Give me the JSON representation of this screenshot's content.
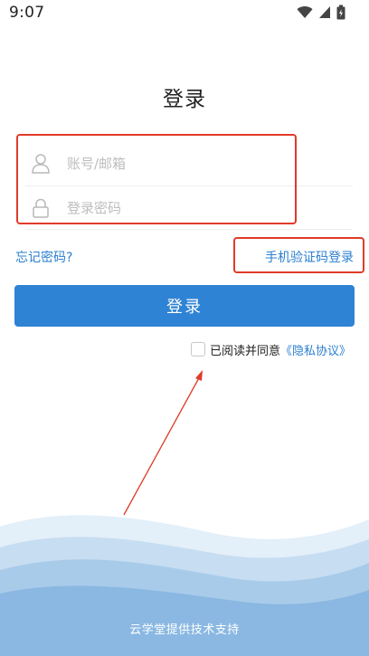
{
  "status_bar": {
    "time": "9:07"
  },
  "page": {
    "title": "登录"
  },
  "form": {
    "account": {
      "placeholder": "账号/邮箱",
      "value": ""
    },
    "password": {
      "placeholder": "登录密码",
      "value": ""
    },
    "forgot_password_label": "忘记密码?",
    "sms_login_label": "手机验证码登录",
    "login_button_label": "登录"
  },
  "agreement": {
    "checked": false,
    "text": "已阅读并同意",
    "link_label": "《隐私协议》"
  },
  "footer": {
    "text": "云学堂提供技术支持"
  },
  "icons": {
    "account": "user-icon",
    "password": "lock-icon",
    "signal": "signal-icon",
    "wifi": "wifi-icon",
    "battery": "battery-icon"
  },
  "colors": {
    "primary": "#2f83d4",
    "link": "#2b7fd0",
    "annotation": "#e03b2a",
    "background": "#ffffff"
  }
}
